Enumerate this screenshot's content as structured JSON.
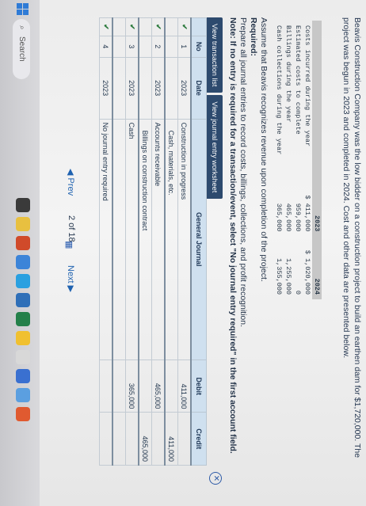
{
  "intro": "Beavis Construction Company was the low bidder on a construction project to build an earthen dam for $1,720,000. The project was begun in 2023 and completed in 2024. Cost and other data are presented below.",
  "data_table": {
    "headers": [
      "",
      "2023",
      "2024"
    ],
    "rows": [
      [
        "Costs incurred during the year",
        "$ 411,000",
        "$ 1,020,000"
      ],
      [
        "Estimated costs to complete",
        "959,000",
        "0"
      ],
      [
        "Billings during the year",
        "465,000",
        "1,255,000"
      ],
      [
        "Cash collections during the year",
        "365,000",
        "1,355,000"
      ]
    ]
  },
  "assume": "Assume that Beavis recognizes revenue upon completion of the project.",
  "required_label": "Required:",
  "required_text": "Prepare all journal entries to record costs, billings, collections, and profit recognition.",
  "note": "Note: If no entry is required for a transaction/event, select \"No journal entry required\" in the first account field.",
  "tabs": [
    "View transaction list",
    "View journal entry worksheet"
  ],
  "journal": {
    "headers": [
      "No",
      "Date",
      "General Journal",
      "Debit",
      "Credit"
    ],
    "rows": [
      {
        "no": "1",
        "date": "2023",
        "account": "Construction in progress",
        "debit": "411,000",
        "credit": "",
        "indent": false,
        "check": true
      },
      {
        "no": "",
        "date": "",
        "account": "Cash, materials, etc.",
        "debit": "",
        "credit": "411,000",
        "indent": true,
        "check": false
      },
      {
        "no": "2",
        "date": "2023",
        "account": "Accounts receivable",
        "debit": "465,000",
        "credit": "",
        "indent": false,
        "check": true
      },
      {
        "no": "",
        "date": "",
        "account": "Billings on construction contract",
        "debit": "",
        "credit": "465,000",
        "indent": true,
        "check": false
      },
      {
        "no": "3",
        "date": "2023",
        "account": "Cash",
        "debit": "365,000",
        "credit": "",
        "indent": false,
        "check": true
      },
      {
        "no": "",
        "date": "",
        "account": "Accounts receivable",
        "debit": "",
        "credit": "365,000",
        "indent": true,
        "check": false
      },
      {
        "no": "4",
        "date": "2023",
        "account": "No journal entry required",
        "debit": "",
        "credit": "",
        "indent": false,
        "check": true
      }
    ]
  },
  "nav": {
    "prev": "Prev",
    "count": "2 of 18",
    "next": "Next"
  },
  "taskbar": {
    "search": "Search"
  },
  "colors": {
    "accent": "#2d4a6e",
    "link": "#1f62b0",
    "check": "#2c7a3c"
  }
}
